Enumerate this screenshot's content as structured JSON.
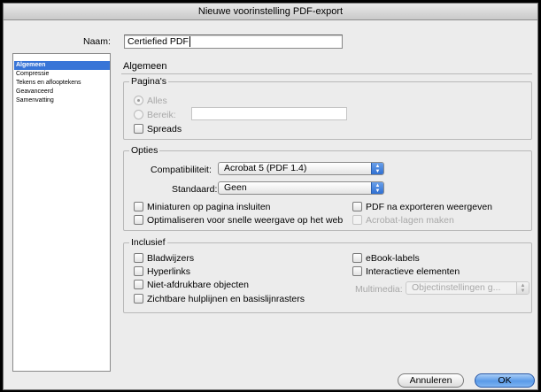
{
  "window": {
    "title": "Nieuwe voorinstelling PDF-export"
  },
  "name_field": {
    "label": "Naam:",
    "value": "Certiefied PDF"
  },
  "sidebar": {
    "items": [
      {
        "label": "Algemeen",
        "selected": true
      },
      {
        "label": "Compressie",
        "selected": false
      },
      {
        "label": "Tekens en aflooptekens",
        "selected": false
      },
      {
        "label": "Geavanceerd",
        "selected": false
      },
      {
        "label": "Samenvatting",
        "selected": false
      }
    ]
  },
  "section_title": "Algemeen",
  "paginas": {
    "label": "Pagina's",
    "radio_all": {
      "label": "Alles",
      "selected": true,
      "enabled": false
    },
    "radio_range": {
      "label": "Bereik:",
      "selected": false,
      "enabled": false
    },
    "range_value": "",
    "spreads": {
      "label": "Spreads",
      "checked": false
    }
  },
  "opties": {
    "label": "Opties",
    "compat_label": "Compatibiliteit:",
    "compat_value": "Acrobat 5 (PDF 1.4)",
    "standard_label": "Standaard:",
    "standard_value": "Geen",
    "thumbnails": {
      "label": "Miniaturen op pagina insluiten",
      "checked": false
    },
    "optimize": {
      "label": "Optimaliseren voor snelle weergave op het web",
      "checked": false
    },
    "view_after": {
      "label": "PDF na exporteren weergeven",
      "checked": false
    },
    "acrobat_layers": {
      "label": "Acrobat-lagen maken",
      "checked": false,
      "enabled": false
    }
  },
  "inclusief": {
    "label": "Inclusief",
    "bookmarks": {
      "label": "Bladwijzers",
      "checked": false
    },
    "hyperlinks": {
      "label": "Hyperlinks",
      "checked": false
    },
    "non_printing": {
      "label": "Niet-afdrukbare objecten",
      "checked": false
    },
    "guides": {
      "label": "Zichtbare hulplijnen en basislijnrasters",
      "checked": false
    },
    "ebook_tags": {
      "label": "eBook-labels",
      "checked": false
    },
    "interactive": {
      "label": "Interactieve elementen",
      "checked": false
    },
    "multimedia_label": "Multimedia:",
    "multimedia_value": "Objectinstellingen g..."
  },
  "buttons": {
    "cancel": "Annuleren",
    "ok": "OK"
  },
  "colors": {
    "accent": "#3875d7",
    "window_bg": "#ececec"
  }
}
